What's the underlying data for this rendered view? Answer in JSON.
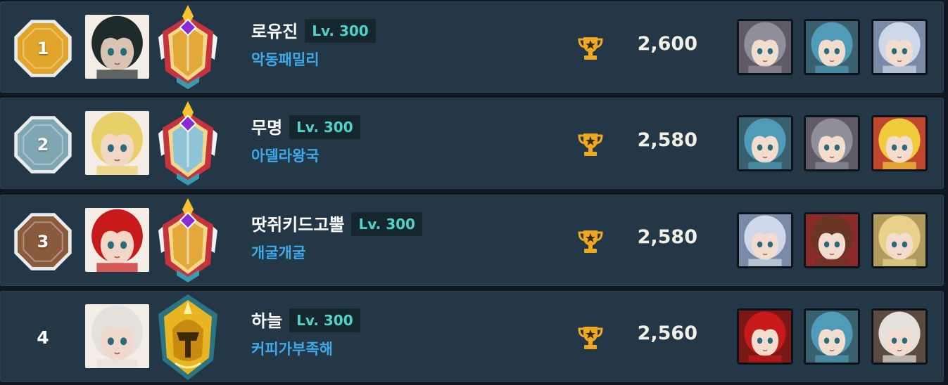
{
  "ranking": {
    "rows": [
      {
        "rank": "1",
        "rank_tier": "gold",
        "rank_color": "#e0a52a",
        "name": "로유진",
        "level": "Lv. 300",
        "guild": "악동패밀리",
        "score": "2,600",
        "avatar_icon": "dark-haired-hero-avatar",
        "avatar_hair": "#1f2a2a",
        "avatar_skin": "#d9c4b4",
        "emblem": "gold-purple-crest-emblem",
        "heroes": [
          {
            "icon": "silver-haired-demon-hero-icon",
            "hair": "#8f8f99",
            "bg": "#5e5a66"
          },
          {
            "icon": "blue-haired-hero-icon",
            "hair": "#4f9bb8",
            "bg": "#3a5f6e"
          },
          {
            "icon": "white-haired-hero-icon",
            "hair": "#cfd8e8",
            "bg": "#7a8aa6"
          }
        ]
      },
      {
        "rank": "2",
        "rank_tier": "silver",
        "rank_color": "#7fa6b3",
        "name": "무명",
        "level": "Lv. 300",
        "guild": "아델라왕국",
        "score": "2,580",
        "avatar_icon": "blonde-hero-avatar",
        "avatar_hair": "#e8cf6a",
        "avatar_skin": "#f1d8c4",
        "emblem": "silver-purple-crest-emblem",
        "heroes": [
          {
            "icon": "blue-haired-hero-icon",
            "hair": "#4f9bb8",
            "bg": "#3a5f6e"
          },
          {
            "icon": "silver-haired-demon-hero-icon",
            "hair": "#8f8f99",
            "bg": "#5e5a66"
          },
          {
            "icon": "blonde-red-bow-hero-icon",
            "hair": "#f0cc3c",
            "bg": "#c0462e"
          }
        ]
      },
      {
        "rank": "3",
        "rank_tier": "bronze",
        "rank_color": "#8a5a3c",
        "name": "땃쥐키드고뿔",
        "level": "Lv. 300",
        "guild": "개굴개굴",
        "score": "2,580",
        "avatar_icon": "red-haired-hero-avatar",
        "avatar_hair": "#c81a1a",
        "avatar_skin": "#f2d6c6",
        "emblem": "bronze-purple-crest-emblem",
        "heroes": [
          {
            "icon": "white-haired-hero-icon",
            "hair": "#cfd8e8",
            "bg": "#7a8aa6"
          },
          {
            "icon": "brown-haired-hero-icon",
            "hair": "#6b3424",
            "bg": "#8a2a2a"
          },
          {
            "icon": "blonde-hero-icon",
            "hair": "#e9d18b",
            "bg": "#b09a5e"
          }
        ]
      },
      {
        "rank": "4",
        "rank_tier": "plain",
        "rank_color": "#ffffff",
        "name": "하늘",
        "level": "Lv. 300",
        "guild": "커피가부족해",
        "score": "2,560",
        "avatar_icon": "white-haired-hero-avatar",
        "avatar_hair": "#e4e0dc",
        "avatar_skin": "#f0d9cc",
        "emblem": "gold-spartan-helmet-emblem",
        "heroes": [
          {
            "icon": "red-haired-hero-icon",
            "hair": "#c81a1a",
            "bg": "#7a1818"
          },
          {
            "icon": "blue-haired-hero-icon",
            "hair": "#4f9bb8",
            "bg": "#3a5f6e"
          },
          {
            "icon": "white-haired-hero-icon",
            "hair": "#e4e0dc",
            "bg": "#5a4a40"
          }
        ]
      }
    ]
  },
  "colors": {
    "row_bg": "#233746",
    "level_text": "#4fd3c8",
    "guild_text": "#3fa9e8",
    "trophy": "#f0a81e"
  }
}
